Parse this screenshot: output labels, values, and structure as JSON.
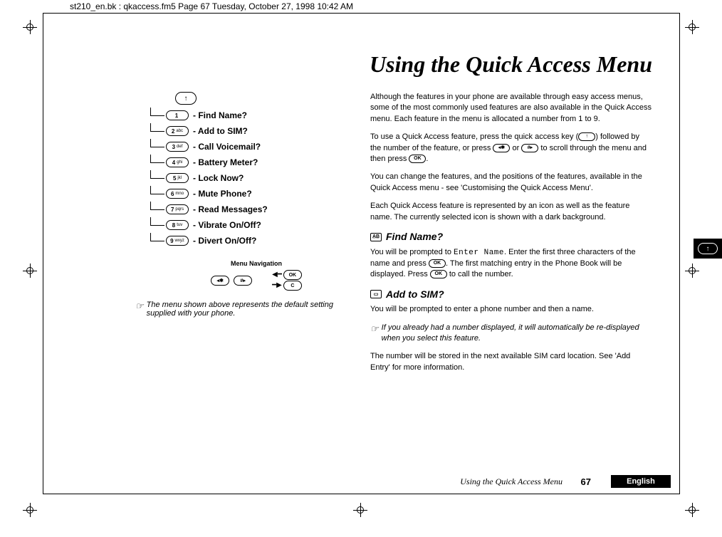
{
  "header": {
    "doc_info": "st210_en.bk : qkaccess.fm5  Page 67  Tuesday, October 27, 1998  10:42 AM"
  },
  "title": "Using the Quick Access Menu",
  "menu": {
    "top_key": "↑",
    "items": [
      {
        "key_num": "1",
        "key_let": "",
        "label": "- Find Name?"
      },
      {
        "key_num": "2",
        "key_let": "abc",
        "label": "- Add to SIM?"
      },
      {
        "key_num": "3",
        "key_let": "def",
        "label": "- Call Voicemail?"
      },
      {
        "key_num": "4",
        "key_let": "ghi",
        "label": "- Battery Meter?"
      },
      {
        "key_num": "5",
        "key_let": "jkl",
        "label": "- Lock Now?"
      },
      {
        "key_num": "6",
        "key_let": "mno",
        "label": "- Mute Phone?"
      },
      {
        "key_num": "7",
        "key_let": "pqrs",
        "label": "- Read Messages?"
      },
      {
        "key_num": "8",
        "key_let": "tuv",
        "label": "- Vibrate On/Off?"
      },
      {
        "key_num": "9",
        "key_let": "wxyz",
        "label": "- Divert On/Off?"
      }
    ],
    "nav_title": "Menu Navigation",
    "nav_star": "◂✱",
    "nav_hash": "#▸",
    "nav_ok": "OK",
    "nav_c": "C"
  },
  "left_note": "The menu shown above represents the default setting supplied with your phone.",
  "body": {
    "p1": "Although the features in your phone are available through easy access menus, some of the most commonly used features are also available in the Quick Access menu. Each feature in the menu is allocated a number from 1 to 9.",
    "p2a": "To use a Quick Access feature, press the quick access key (",
    "key_up": "↑",
    "p2b": ") followed by the number of the feature, or press ",
    "key_star": "◂✱",
    "p2c": " or ",
    "key_hash": "#▸",
    "p2d": " to scroll through the menu and then press ",
    "key_ok": "OK",
    "p2e": ".",
    "p3": "You can change the features, and the positions of the features, available in the Quick Access menu - see 'Customising the Quick Access Menu'.",
    "p4": "Each Quick Access feature is represented by an icon as well as the feature name. The currently selected icon is shown with a dark background.",
    "sec1": {
      "title": "Find Name?",
      "p_a": "You will be prompted to ",
      "tt": "Enter Name",
      "p_b": ". Enter the first three characters of the name and press ",
      "p_c": ". The first matching entry in the Phone Book will be displayed. Press ",
      "p_d": " to call the number."
    },
    "sec2": {
      "title": "Add to SIM?",
      "p1": "You will be prompted to enter a phone number and then a name.",
      "note": "If you already had a number displayed, it will automatically be re-displayed when you select this feature.",
      "p2": "The number will be stored in the next available SIM card location. See 'Add Entry' for more information."
    }
  },
  "thumb_tab": "↑",
  "footer": {
    "running": "Using the Quick Access Menu",
    "page": "67",
    "lang": "English"
  }
}
